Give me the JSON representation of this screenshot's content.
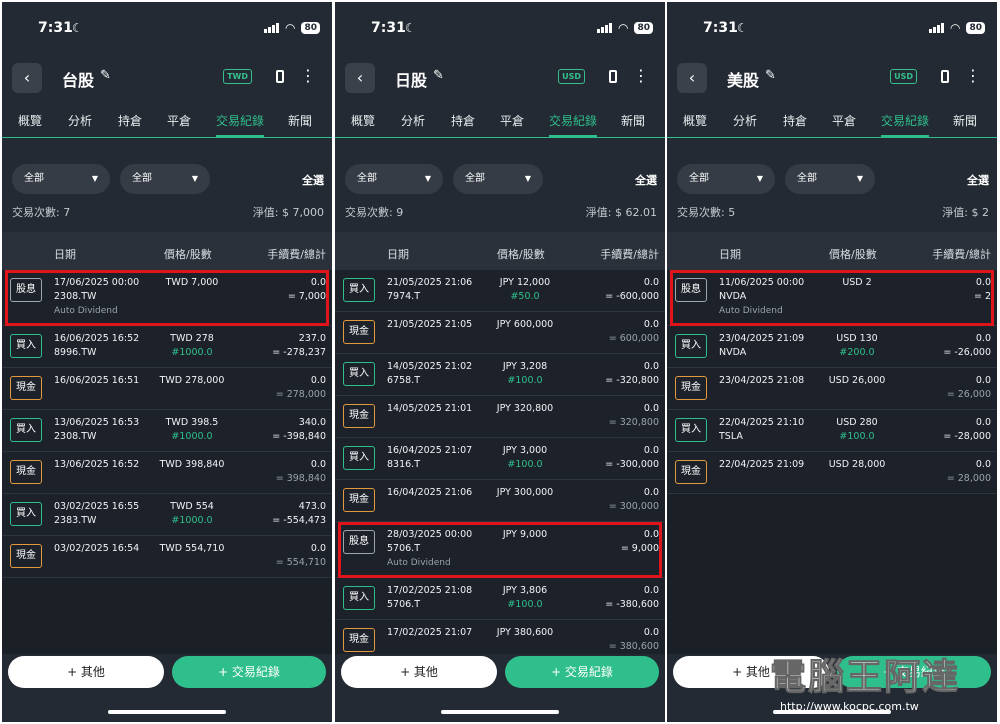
{
  "status": {
    "time": "7:31",
    "battery": "80"
  },
  "tabs": [
    "概覽",
    "分析",
    "持倉",
    "平倉",
    "交易紀錄",
    "新聞"
  ],
  "filters": {
    "dd1": "全部",
    "dd2": "全部",
    "select_all": "全選"
  },
  "columns": {
    "date": "日期",
    "price": "價格/股數",
    "fee": "手續費/總計"
  },
  "buttons": {
    "other": "+ 其他",
    "record": "+ 交易紀錄"
  },
  "tags": {
    "buy": "買入",
    "cash": "現金",
    "div": "股息"
  },
  "watermark": {
    "text": "電腦王阿達",
    "url": "http://www.kocpc.com.tw"
  },
  "screens": [
    {
      "title": "台股",
      "currency": "TWD",
      "count_text": "交易次數:  7",
      "net_text": "淨值:  $ 7,000",
      "rows": [
        {
          "type": "div",
          "date": "17/06/2025 00:00",
          "sym": "2308.TW",
          "note": "Auto Dividend",
          "price": "TWD 7,000",
          "qty": "",
          "fee": "0.0",
          "total": "= 7,000",
          "highlight": true
        },
        {
          "type": "buy",
          "date": "16/06/2025 16:52",
          "sym": "8996.TW",
          "price": "TWD 278",
          "qty": "#1000.0",
          "fee": "237.0",
          "total": "= -278,237"
        },
        {
          "type": "cash",
          "date": "16/06/2025 16:51",
          "sym": "",
          "price": "TWD 278,000",
          "qty": "",
          "fee": "0.0",
          "total": "= 278,000"
        },
        {
          "type": "buy",
          "date": "13/06/2025 16:53",
          "sym": "2308.TW",
          "price": "TWD 398.5",
          "qty": "#1000.0",
          "fee": "340.0",
          "total": "= -398,840"
        },
        {
          "type": "cash",
          "date": "13/06/2025 16:52",
          "sym": "",
          "price": "TWD 398,840",
          "qty": "",
          "fee": "0.0",
          "total": "= 398,840"
        },
        {
          "type": "buy",
          "date": "03/02/2025 16:55",
          "sym": "2383.TW",
          "price": "TWD 554",
          "qty": "#1000.0",
          "fee": "473.0",
          "total": "= -554,473"
        },
        {
          "type": "cash",
          "date": "03/02/2025 16:54",
          "sym": "",
          "price": "TWD 554,710",
          "qty": "",
          "fee": "0.0",
          "total": "= 554,710"
        }
      ]
    },
    {
      "title": "日股",
      "currency": "USD",
      "count_text": "交易次數:  9",
      "net_text": "淨值:  $ 62.01",
      "rows": [
        {
          "type": "buy",
          "date": "21/05/2025 21:06",
          "sym": "7974.T",
          "price": "JPY 12,000",
          "qty": "#50.0",
          "fee": "0.0",
          "total": "= -600,000"
        },
        {
          "type": "cash",
          "date": "21/05/2025 21:05",
          "sym": "",
          "price": "JPY 600,000",
          "qty": "",
          "fee": "0.0",
          "total": "= 600,000"
        },
        {
          "type": "buy",
          "date": "14/05/2025 21:02",
          "sym": "6758.T",
          "price": "JPY 3,208",
          "qty": "#100.0",
          "fee": "0.0",
          "total": "= -320,800"
        },
        {
          "type": "cash",
          "date": "14/05/2025 21:01",
          "sym": "",
          "price": "JPY 320,800",
          "qty": "",
          "fee": "0.0",
          "total": "= 320,800"
        },
        {
          "type": "buy",
          "date": "16/04/2025 21:07",
          "sym": "8316.T",
          "price": "JPY 3,000",
          "qty": "#100.0",
          "fee": "0.0",
          "total": "= -300,000"
        },
        {
          "type": "cash",
          "date": "16/04/2025 21:06",
          "sym": "",
          "price": "JPY 300,000",
          "qty": "",
          "fee": "0.0",
          "total": "= 300,000"
        },
        {
          "type": "div",
          "date": "28/03/2025 00:00",
          "sym": "5706.T",
          "note": "Auto Dividend",
          "price": "JPY 9,000",
          "qty": "",
          "fee": "0.0",
          "total": "= 9,000",
          "highlight": true
        },
        {
          "type": "buy",
          "date": "17/02/2025 21:08",
          "sym": "5706.T",
          "price": "JPY 3,806",
          "qty": "#100.0",
          "fee": "0.0",
          "total": "= -380,600"
        },
        {
          "type": "cash",
          "date": "17/02/2025 21:07",
          "sym": "",
          "price": "JPY 380,600",
          "qty": "",
          "fee": "0.0",
          "total": "= 380,600"
        }
      ]
    },
    {
      "title": "美股",
      "currency": "USD",
      "count_text": "交易次數:  5",
      "net_text": "淨值:  $ 2",
      "rows": [
        {
          "type": "div",
          "date": "11/06/2025 00:00",
          "sym": "NVDA",
          "note": "Auto Dividend",
          "price": "USD 2",
          "qty": "",
          "fee": "0.0",
          "total": "= 2",
          "highlight": true
        },
        {
          "type": "buy",
          "date": "23/04/2025 21:09",
          "sym": "NVDA",
          "price": "USD 130",
          "qty": "#200.0",
          "fee": "0.0",
          "total": "= -26,000"
        },
        {
          "type": "cash",
          "date": "23/04/2025 21:08",
          "sym": "",
          "price": "USD 26,000",
          "qty": "",
          "fee": "0.0",
          "total": "= 26,000"
        },
        {
          "type": "buy",
          "date": "22/04/2025 21:10",
          "sym": "TSLA",
          "price": "USD 280",
          "qty": "#100.0",
          "fee": "0.0",
          "total": "= -28,000"
        },
        {
          "type": "cash",
          "date": "22/04/2025 21:09",
          "sym": "",
          "price": "USD 28,000",
          "qty": "",
          "fee": "0.0",
          "total": "= 28,000"
        }
      ]
    }
  ]
}
